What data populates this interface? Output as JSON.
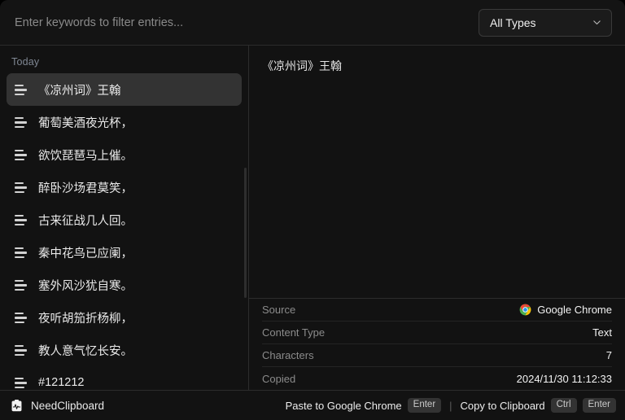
{
  "search": {
    "placeholder": "Enter keywords to filter entries...",
    "value": ""
  },
  "type_filter": {
    "selected": "All Types",
    "icon": "chevron-down-icon"
  },
  "list": {
    "group_label": "Today",
    "items": [
      {
        "text": "《凉州词》王翰",
        "icon": "lines-icon",
        "selected": true
      },
      {
        "text": "葡萄美酒夜光杯，",
        "icon": "lines-icon",
        "selected": false
      },
      {
        "text": "欲饮琵琶马上催。",
        "icon": "lines-icon",
        "selected": false
      },
      {
        "text": "醉卧沙场君莫笑，",
        "icon": "lines-icon",
        "selected": false
      },
      {
        "text": "古来征战几人回。",
        "icon": "lines-icon",
        "selected": false
      },
      {
        "text": "秦中花鸟已应阑，",
        "icon": "lines-icon",
        "selected": false
      },
      {
        "text": "塞外风沙犹自寒。",
        "icon": "lines-icon",
        "selected": false
      },
      {
        "text": "夜听胡笳折杨柳，",
        "icon": "lines-icon",
        "selected": false
      },
      {
        "text": "教人意气忆长安。",
        "icon": "lines-icon",
        "selected": false
      },
      {
        "text": "#121212",
        "icon": "lines-icon",
        "selected": false
      }
    ]
  },
  "detail": {
    "content": "《凉州词》王翰",
    "meta": [
      {
        "label": "Source",
        "value": "Google Chrome",
        "icon": "chrome-icon"
      },
      {
        "label": "Content Type",
        "value": "Text",
        "icon": ""
      },
      {
        "label": "Characters",
        "value": "7",
        "icon": ""
      },
      {
        "label": "Copied",
        "value": "2024/11/30 11:12:33",
        "icon": ""
      }
    ]
  },
  "statusbar": {
    "brand": "NeedClipboard",
    "brand_icon": "clipboard-icon",
    "paste_action": "Paste to Google Chrome",
    "paste_key": "Enter",
    "separator": "|",
    "copy_action": "Copy to Clipboard",
    "copy_key_1": "Ctrl",
    "copy_key_2": "Enter"
  },
  "colors": {
    "background": "#121212",
    "topbar": "#141414",
    "selected_row": "#333333",
    "divider": "#2c2c2c",
    "muted_text": "#8b8b8b",
    "primary_text": "#eaeaea"
  }
}
